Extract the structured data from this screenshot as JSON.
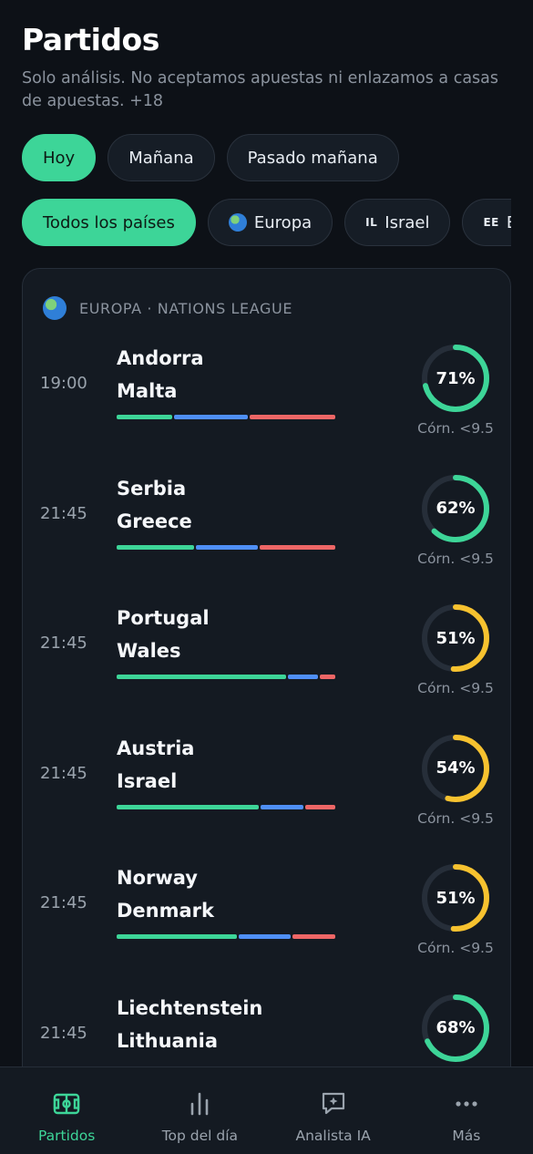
{
  "header": {
    "title": "Partidos",
    "subtitle": "Solo análisis. No aceptamos apuestas ni enlazamos a casas de apuestas. +18"
  },
  "day_filters": [
    {
      "label": "Hoy",
      "active": true
    },
    {
      "label": "Mañana",
      "active": false
    },
    {
      "label": "Pasado mañana",
      "active": false
    }
  ],
  "country_filters": [
    {
      "label": "Todos los países",
      "active": true
    },
    {
      "label": "Europa",
      "icon": "globe-icon",
      "active": false
    },
    {
      "label": "Israel",
      "code": "IL",
      "active": false
    },
    {
      "label": "Es",
      "code": "EE",
      "active": false
    }
  ],
  "league": {
    "icon": "globe-icon",
    "name": "EUROPA · NATIONS LEAGUE"
  },
  "matches": [
    {
      "time": "19:00",
      "home": "Andorra",
      "away": "Malta",
      "probability": "71%",
      "prob_value": 71,
      "market": "Córn. <9.5",
      "bar": [
        26,
        34,
        40
      ],
      "color": "#3dd598"
    },
    {
      "time": "21:45",
      "home": "Serbia",
      "away": "Greece",
      "probability": "62%",
      "prob_value": 62,
      "market": "Córn. <9.5",
      "bar": [
        36,
        29,
        35
      ],
      "color": "#3dd598"
    },
    {
      "time": "21:45",
      "home": "Portugal",
      "away": "Wales",
      "probability": "51%",
      "prob_value": 51,
      "market": "Córn. <9.5",
      "bar": [
        79,
        14,
        7
      ],
      "color": "#f7c22f"
    },
    {
      "time": "21:45",
      "home": "Austria",
      "away": "Israel",
      "probability": "54%",
      "prob_value": 54,
      "market": "Córn. <9.5",
      "bar": [
        66,
        20,
        14
      ],
      "color": "#f7c22f"
    },
    {
      "time": "21:45",
      "home": "Norway",
      "away": "Denmark",
      "probability": "51%",
      "prob_value": 51,
      "market": "Córn. <9.5",
      "bar": [
        56,
        24,
        20
      ],
      "color": "#f7c22f"
    },
    {
      "time": "21:45",
      "home": "Liechtenstein",
      "away": "Lithuania",
      "probability": "68%",
      "prob_value": 68,
      "market": "",
      "bar": [],
      "color": "#3dd598"
    }
  ],
  "tabs": [
    {
      "label": "Partidos",
      "icon": "pitch-icon",
      "active": true
    },
    {
      "label": "Top del día",
      "icon": "bar-chart-icon",
      "active": false
    },
    {
      "label": "Analista IA",
      "icon": "chat-sparkle-icon",
      "active": false
    },
    {
      "label": "Más",
      "icon": "more-dots-icon",
      "active": false
    }
  ],
  "colors": {
    "accent": "#3dd598",
    "warning": "#f7c22f",
    "draw": "#4f8ff7",
    "away": "#ee6666",
    "background": "#0d1117",
    "card": "#141a22"
  }
}
